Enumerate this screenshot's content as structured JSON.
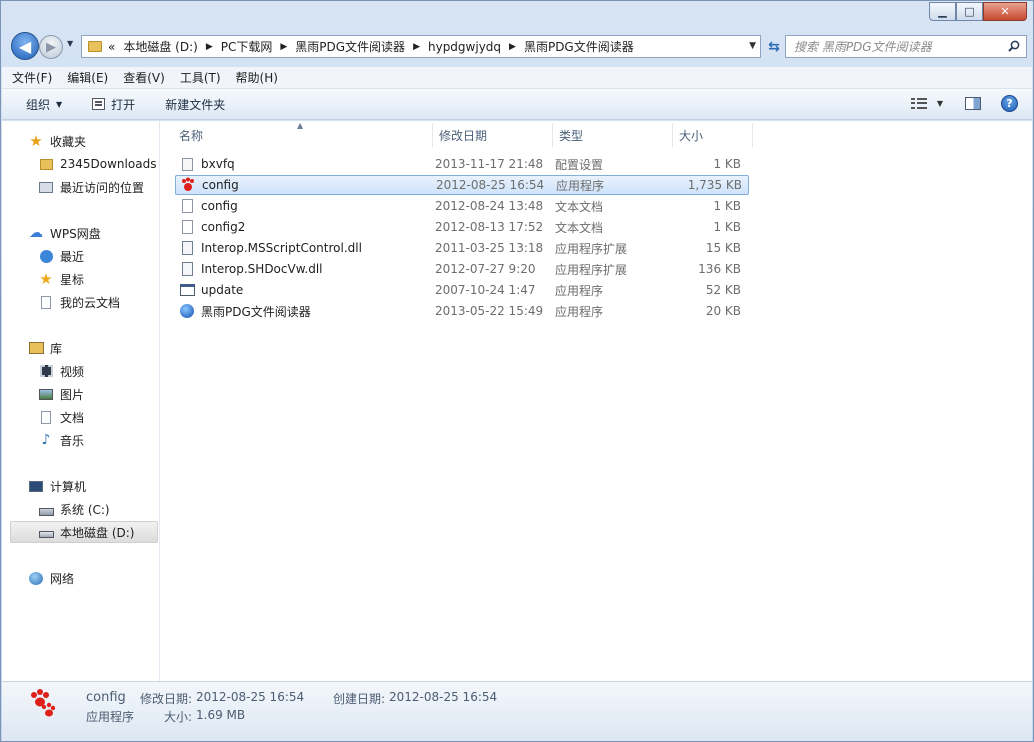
{
  "titlebar": {
    "min": "▁",
    "max": "□",
    "close": "✕"
  },
  "address": {
    "prefix": "«",
    "crumbs": [
      "本地磁盘 (D:)",
      "PC下载网",
      "黑雨PDG文件阅读器",
      "hypdgwjydq",
      "黑雨PDG文件阅读器"
    ],
    "search_placeholder": "搜索 黑雨PDG文件阅读器"
  },
  "menu": [
    "文件(F)",
    "编辑(E)",
    "查看(V)",
    "工具(T)",
    "帮助(H)"
  ],
  "toolbar": {
    "organize": "组织",
    "open": "打开",
    "new_folder": "新建文件夹"
  },
  "nav": {
    "favorites": "收藏夹",
    "fav_items": [
      "2345Downloads",
      "最近访问的位置"
    ],
    "wps": "WPS网盘",
    "wps_items": [
      "最近",
      "星标",
      "我的云文档"
    ],
    "library": "库",
    "lib_items": [
      "视频",
      "图片",
      "文档",
      "音乐"
    ],
    "computer": "计算机",
    "comp_items": [
      "系统 (C:)",
      "本地磁盘 (D:)"
    ],
    "network": "网络"
  },
  "columns": [
    "名称",
    "修改日期",
    "类型",
    "大小"
  ],
  "files": [
    {
      "name": "bxvfq",
      "date": "2013-11-17 21:48",
      "type": "配置设置",
      "size": "1 KB",
      "icon": "settings-file-icon"
    },
    {
      "name": "config",
      "date": "2012-08-25 16:54",
      "type": "应用程序",
      "size": "1,735 KB",
      "icon": "paw-app-icon",
      "selected": true
    },
    {
      "name": "config",
      "date": "2012-08-24 13:48",
      "type": "文本文档",
      "size": "1 KB",
      "icon": "text-file-icon"
    },
    {
      "name": "config2",
      "date": "2012-08-13 17:52",
      "type": "文本文档",
      "size": "1 KB",
      "icon": "text-file-icon"
    },
    {
      "name": "Interop.MSScriptControl.dll",
      "date": "2011-03-25 13:18",
      "type": "应用程序扩展",
      "size": "15 KB",
      "icon": "dll-file-icon"
    },
    {
      "name": "Interop.SHDocVw.dll",
      "date": "2012-07-27 9:20",
      "type": "应用程序扩展",
      "size": "136 KB",
      "icon": "dll-file-icon"
    },
    {
      "name": "update",
      "date": "2007-10-24 1:47",
      "type": "应用程序",
      "size": "52 KB",
      "icon": "exe-window-icon"
    },
    {
      "name": "黑雨PDG文件阅读器",
      "date": "2013-05-22 15:49",
      "type": "应用程序",
      "size": "20 KB",
      "icon": "blue-orb-app-icon"
    }
  ],
  "details": {
    "name": "config",
    "type": "应用程序",
    "modified_label": "修改日期:",
    "modified": "2012-08-25 16:54",
    "created_label": "创建日期:",
    "created": "2012-08-25 16:54",
    "size_label": "大小:",
    "size": "1.69 MB"
  },
  "colors": {
    "selection": "#cfe3fa",
    "accent": "#1f5fb9",
    "paw": "#e0201b"
  }
}
